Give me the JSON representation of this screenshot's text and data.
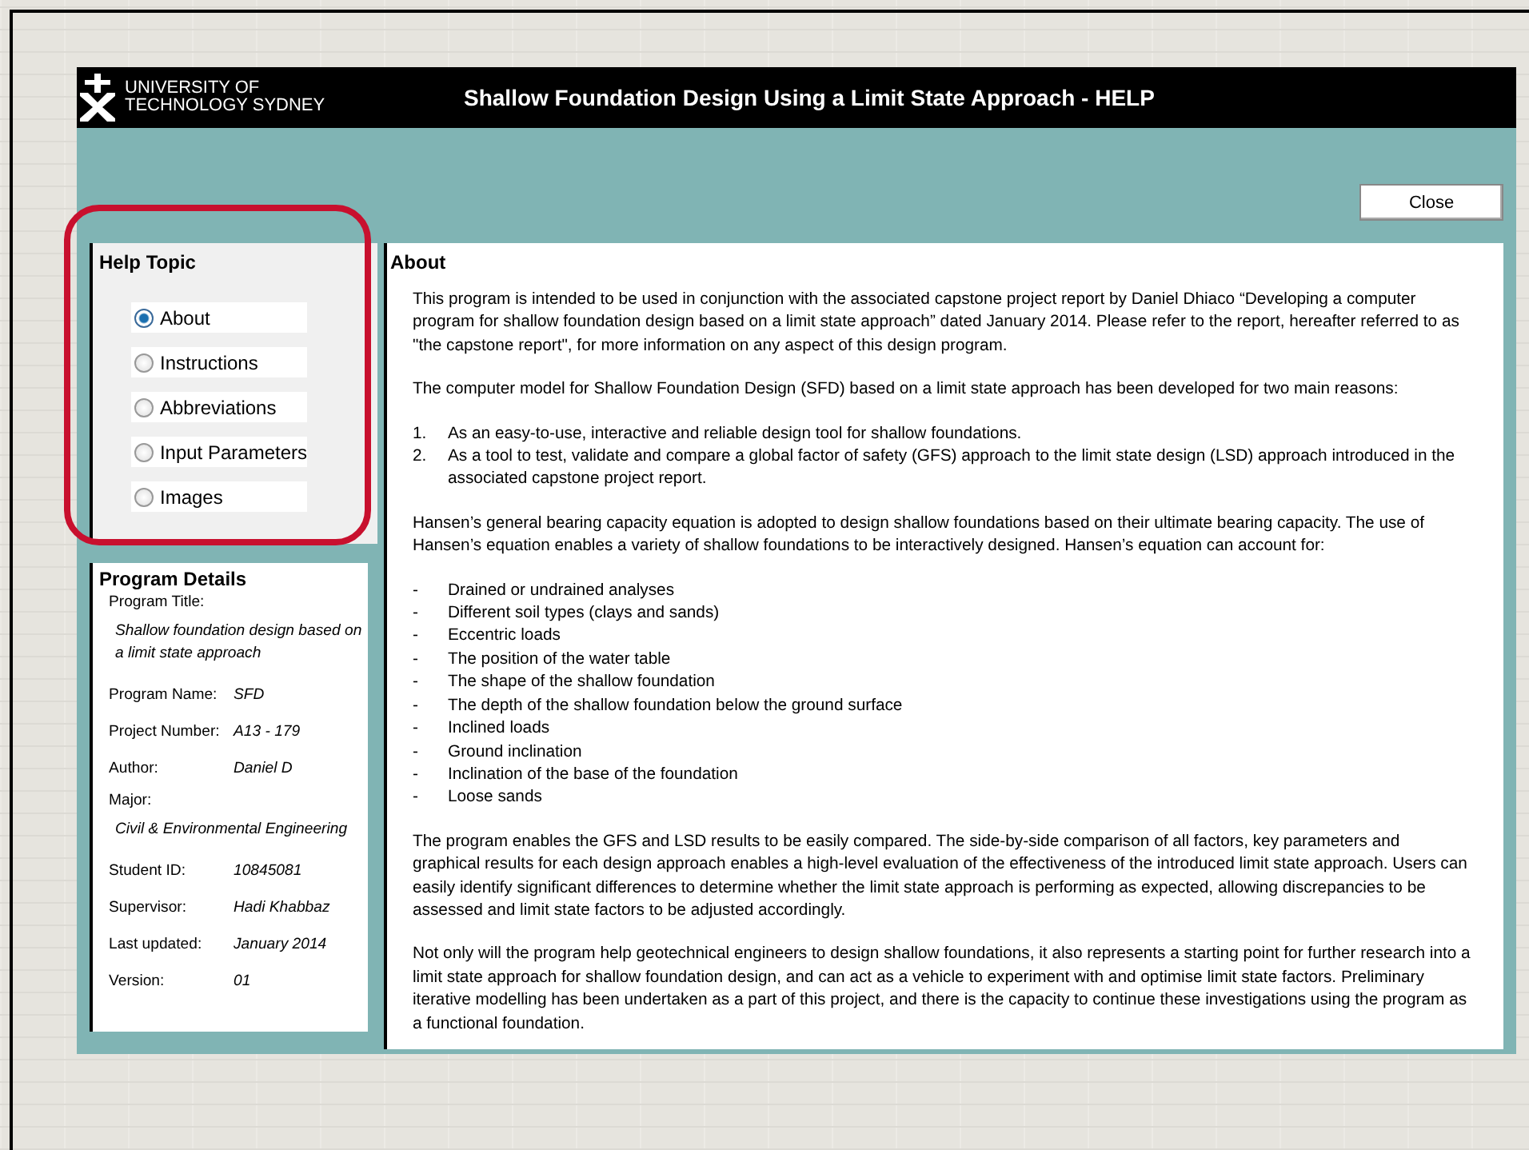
{
  "header": {
    "logo_lines": [
      "UNIVERSITY OF",
      "TECHNOLOGY SYDNEY"
    ],
    "title": "Shallow Foundation Design Using a Limit State Approach - HELP"
  },
  "close_button": "Close",
  "help_topic": {
    "title": "Help Topic",
    "highlighted": true,
    "options": [
      {
        "label": "About",
        "selected": true
      },
      {
        "label": "Instructions",
        "selected": false
      },
      {
        "label": "Abbreviations",
        "selected": false
      },
      {
        "label": "Input Parameters",
        "selected": false
      },
      {
        "label": "Images",
        "selected": false
      }
    ]
  },
  "program_details": {
    "title": "Program Details",
    "fields": [
      {
        "kind": "stacked",
        "label": "Program Title:",
        "value": "Shallow foundation design based on a limit state approach"
      },
      {
        "kind": "inline",
        "label": "Program Name:",
        "value": "SFD"
      },
      {
        "kind": "inline",
        "label": "Project Number:",
        "value": "A13 - 179"
      },
      {
        "kind": "inline",
        "label": "Author:",
        "value": "Daniel D"
      },
      {
        "kind": "stacked",
        "label": "Major:",
        "value": "Civil & Environmental Engineering"
      },
      {
        "kind": "inline",
        "label": "Student ID:",
        "value": "10845081"
      },
      {
        "kind": "inline",
        "label": "Supervisor:",
        "value": "Hadi Khabbaz"
      },
      {
        "kind": "inline",
        "label": "Last updated:",
        "value": "January 2014"
      },
      {
        "kind": "inline",
        "label": "Version:",
        "value": "01"
      }
    ]
  },
  "about": {
    "title": "About",
    "blocks": [
      {
        "kind": "paragraph",
        "text": "This program is intended to be used in conjunction with the associated capstone project report by Daniel Dhiaco “Developing a computer program for shallow foundation design based on a limit state approach” dated January 2014. Please refer to the report, hereafter referred to as \"the capstone report\", for more information on any aspect of this design program."
      },
      {
        "kind": "paragraph",
        "text": "The computer model for Shallow Foundation Design (SFD) based on a limit state approach has been developed for two main reasons:"
      },
      {
        "kind": "list",
        "items": [
          {
            "marker": "1.",
            "text": "As an easy-to-use, interactive and reliable design tool for shallow foundations."
          },
          {
            "marker": "2.",
            "text": "As a tool to test, validate and compare a global factor of safety (GFS) approach to the limit state design (LSD) approach introduced in the associated capstone project report."
          }
        ]
      },
      {
        "kind": "paragraph",
        "text": "Hansen’s general bearing capacity equation is adopted to design shallow foundations based on their ultimate bearing capacity. The use of Hansen’s equation enables a variety of shallow foundations to be interactively designed.  Hansen’s equation can account for:"
      },
      {
        "kind": "list",
        "items": [
          {
            "marker": "-",
            "text": "Drained or undrained analyses"
          },
          {
            "marker": "-",
            "text": "Different soil types (clays and sands)"
          },
          {
            "marker": "-",
            "text": "Eccentric loads"
          },
          {
            "marker": "-",
            "text": "The position of the water table"
          },
          {
            "marker": "-",
            "text": "The shape of the shallow foundation"
          },
          {
            "marker": "-",
            "text": "The depth of the shallow foundation below the ground surface"
          },
          {
            "marker": "-",
            "text": "Inclined loads"
          },
          {
            "marker": "-",
            "text": "Ground inclination"
          },
          {
            "marker": "-",
            "text": "Inclination of the base of the foundation"
          },
          {
            "marker": "-",
            "text": "Loose sands"
          }
        ]
      },
      {
        "kind": "paragraph",
        "text": "The program enables the GFS and LSD results to be easily compared. The side-by-side comparison of all factors, key parameters and graphical results for each design approach enables a high-level evaluation of the effectiveness of the introduced limit state approach. Users can easily identify significant differences to determine whether the limit state approach is performing as expected, allowing discrepancies to be assessed and limit state factors to be adjusted accordingly."
      },
      {
        "kind": "paragraph",
        "text": "Not only will the program help geotechnical engineers to design shallow foundations, it also represents a starting point for further research into a limit state approach for shallow foundation design, and can act as a vehicle to experiment with and optimise limit state factors. Preliminary iterative modelling has been undertaken as a part of this project, and there is the capacity to continue these investigations using the program as a functional foundation."
      }
    ]
  }
}
